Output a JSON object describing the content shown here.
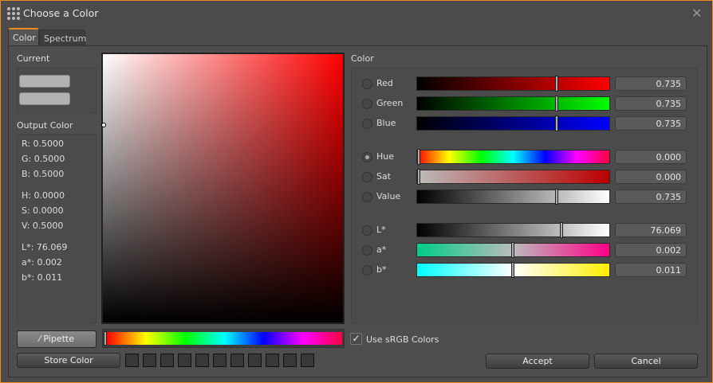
{
  "window": {
    "title": "Choose a Color",
    "close_icon": "close-icon"
  },
  "tabs": [
    {
      "label": "Color"
    },
    {
      "label": "Spectrum"
    }
  ],
  "current": {
    "label": "Current"
  },
  "output": {
    "label": "Output Color",
    "lines": [
      "R: 0.5000",
      "G: 0.5000",
      "B: 0.5000",
      "H: 0.0000",
      "S: 0.0000",
      "V: 0.5000",
      "L*: 76.069",
      "a*: 0.002",
      "b*: 0.011"
    ]
  },
  "color_group": {
    "label": "Color"
  },
  "channels": [
    {
      "label": "Red",
      "value": "0.735",
      "pos": 0.735,
      "grad": "linear-gradient(to right,#000,#f00)",
      "selected": false
    },
    {
      "label": "Green",
      "value": "0.735",
      "pos": 0.735,
      "grad": "linear-gradient(to right,#000,#0f0)",
      "selected": false
    },
    {
      "label": "Blue",
      "value": "0.735",
      "pos": 0.735,
      "grad": "linear-gradient(to right,#000,#00f)",
      "selected": false
    },
    {
      "label": "Hue",
      "value": "0.000",
      "pos": 0,
      "grad": "linear-gradient(to right,#f00,#ff0,#0f0,#0ff,#00f,#f0f,#f04)",
      "selected": true
    },
    {
      "label": "Sat",
      "value": "0.000",
      "pos": 0,
      "grad": "linear-gradient(to right,#bbb,#b00)",
      "selected": false
    },
    {
      "label": "Value",
      "value": "0.735",
      "pos": 0.735,
      "grad": "linear-gradient(to right,#000,#fff)",
      "selected": false
    },
    {
      "label": "L*",
      "value": "76.069",
      "pos": 0.76,
      "grad": "linear-gradient(to right,#000,#fff)",
      "selected": false
    },
    {
      "label": "a*",
      "value": "0.002",
      "pos": 0.5,
      "grad": "linear-gradient(to right,#0c8,#bbb 50%,#f08)",
      "selected": false
    },
    {
      "label": "b*",
      "value": "0.011",
      "pos": 0.5,
      "grad": "linear-gradient(to right,#0ff,#fff 50%,#fe0)",
      "selected": false
    }
  ],
  "buttons": {
    "pipette": "Pipette",
    "store": "Store Color",
    "accept": "Accept",
    "cancel": "Cancel"
  },
  "srgb": {
    "label": "Use sRGB Colors",
    "checked": true
  },
  "stored_count": 11
}
